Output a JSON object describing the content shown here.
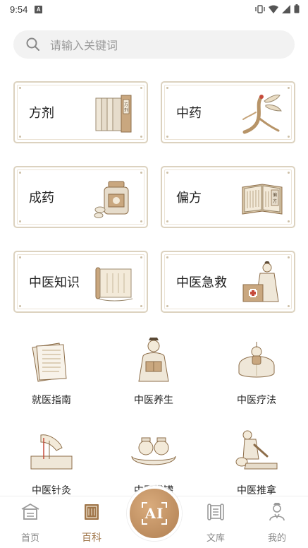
{
  "status_bar": {
    "time": "9:54",
    "a_badge": "A"
  },
  "search": {
    "placeholder": "请输入关键词"
  },
  "cards": [
    {
      "label": "方剂",
      "icon": "scroll-books-icon"
    },
    {
      "label": "中药",
      "icon": "ginseng-icon"
    },
    {
      "label": "成药",
      "icon": "medicine-bottle-icon"
    },
    {
      "label": "偏方",
      "icon": "open-book-icon"
    },
    {
      "label": "中医知识",
      "icon": "scroll-icon"
    },
    {
      "label": "中医急救",
      "icon": "doctor-first-aid-icon"
    }
  ],
  "grid": [
    {
      "label": "就医指南",
      "icon": "paper-notes-icon"
    },
    {
      "label": "中医养生",
      "icon": "scholar-reading-icon"
    },
    {
      "label": "中医疗法",
      "icon": "cupping-back-icon"
    },
    {
      "label": "中医针灸",
      "icon": "acupuncture-icon"
    },
    {
      "label": "中医拔罐",
      "icon": "cupping-jars-icon"
    },
    {
      "label": "中医推拿",
      "icon": "massage-icon"
    }
  ],
  "bottom_nav": {
    "items": [
      {
        "label": "首页",
        "icon": "home-icon"
      },
      {
        "label": "百科",
        "icon": "encyclopedia-icon"
      },
      {
        "label": "文库",
        "icon": "library-icon"
      },
      {
        "label": "我的",
        "icon": "profile-icon"
      }
    ],
    "ai_label": "AI",
    "active_index": 1
  },
  "colors": {
    "accent": "#a0764a",
    "card_border": "#dcd2bf",
    "ai_button": "#c49366"
  }
}
